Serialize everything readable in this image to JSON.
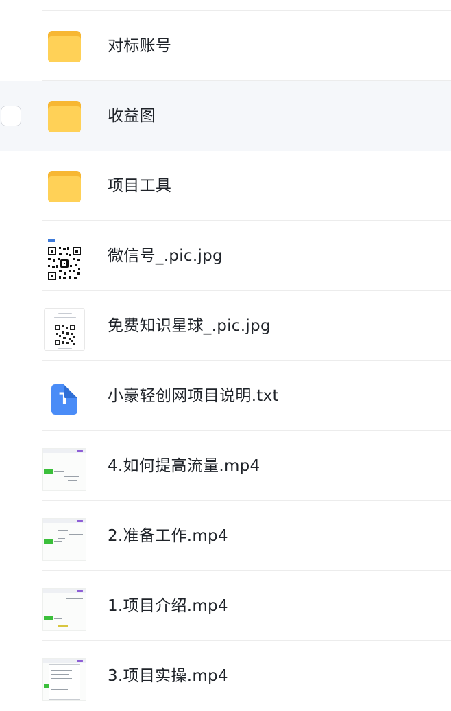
{
  "files": [
    {
      "name": "对标账号",
      "kind": "folder",
      "icon": "folder-icon"
    },
    {
      "name": "收益图",
      "kind": "folder",
      "icon": "folder-icon",
      "hovered": true
    },
    {
      "name": "项目工具",
      "kind": "folder",
      "icon": "folder-icon"
    },
    {
      "name": "微信号_.pic.jpg",
      "kind": "image-qr",
      "icon": "qr-code-thumbnail-icon"
    },
    {
      "name": "免费知识星球_.pic.jpg",
      "kind": "image-card",
      "icon": "qr-card-thumbnail-icon"
    },
    {
      "name": "小豪轻创网项目说明.txt",
      "kind": "txt",
      "icon": "text-file-icon",
      "icon_letter": "T"
    },
    {
      "name": "4.如何提高流量.mp4",
      "kind": "video",
      "icon": "video-thumbnail-icon"
    },
    {
      "name": "2.准备工作.mp4",
      "kind": "video",
      "icon": "video-thumbnail-icon"
    },
    {
      "name": "1.项目介绍.mp4",
      "kind": "video",
      "icon": "video-thumbnail-icon"
    },
    {
      "name": "3.项目实操.mp4",
      "kind": "video",
      "icon": "video-thumbnail-icon"
    }
  ],
  "colors": {
    "folder_front": "#ffd157",
    "folder_back": "#f7b733",
    "txt_icon": "#4a8cf7",
    "hover_row": "#f5f7fa",
    "text": "#1f2329"
  }
}
